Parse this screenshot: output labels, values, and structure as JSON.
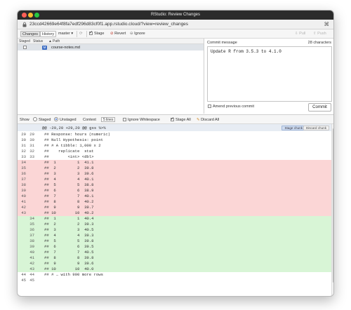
{
  "window": {
    "title": "RStudio: Review Changes"
  },
  "urlbar": {
    "url": "23ccd42669e64f8fa7edf296d83cf0f1.app.rstudio.cloud/?view=review_changes"
  },
  "toolbar": {
    "changes_label": "Changes",
    "history_label": "History",
    "branch_label": "master",
    "stage_label": "Stage",
    "revert_label": "Revert",
    "ignore_label": "Ignore",
    "pull_label": "Pull",
    "push_label": "Push"
  },
  "file_list": {
    "headers": {
      "staged": "Staged",
      "status": "Status",
      "path": "Path"
    },
    "files": [
      {
        "status": "M",
        "path": "course-notes.md",
        "staged": false
      }
    ]
  },
  "commit": {
    "label": "Commit message",
    "char_count": "28 characters",
    "message": "Update R from 3.5.3 to 4.1.0",
    "amend_label": "Amend previous commit",
    "commit_button": "Commit"
  },
  "diff_toolbar": {
    "show_label": "Show",
    "staged_label": "Staged",
    "unstaged_label": "Unstaged",
    "context_label": "Context",
    "context_value": "5 lines",
    "ignore_ws_label": "Ignore Whitespace",
    "stage_all_label": "Stage All",
    "discard_all_label": "Discard All",
    "show_selected": "Unstaged"
  },
  "diff": {
    "hunk_header": "@@ -29,20 +29,20 @@ gss %>%",
    "stage_chunk_label": "Stage chunk",
    "discard_chunk_label": "Discard chunk",
    "lines": [
      {
        "type": "context",
        "old": "29",
        "new": "29",
        "text": "## Response: hours (numeric)"
      },
      {
        "type": "context",
        "old": "30",
        "new": "30",
        "text": "## Null Hypothesis: point"
      },
      {
        "type": "context",
        "old": "31",
        "new": "31",
        "text": "## # A tibble: 1,000 x 2"
      },
      {
        "type": "context",
        "old": "32",
        "new": "32",
        "text": "##    replicate  stat"
      },
      {
        "type": "context",
        "old": "33",
        "new": "33",
        "text": "##        <int> <dbl>"
      },
      {
        "type": "del",
        "old": "34",
        "new": "",
        "text": "##  1         1  41.1"
      },
      {
        "type": "del",
        "old": "35",
        "new": "",
        "text": "##  2         2  39.8"
      },
      {
        "type": "del",
        "old": "36",
        "new": "",
        "text": "##  3         3  39.6"
      },
      {
        "type": "del",
        "old": "37",
        "new": "",
        "text": "##  4         4  40.1"
      },
      {
        "type": "del",
        "old": "38",
        "new": "",
        "text": "##  5         5  38.8"
      },
      {
        "type": "del",
        "old": "39",
        "new": "",
        "text": "##  6         6  38.9"
      },
      {
        "type": "del",
        "old": "40",
        "new": "",
        "text": "##  7         7  40.1"
      },
      {
        "type": "del",
        "old": "41",
        "new": "",
        "text": "##  8         8  40.2"
      },
      {
        "type": "del",
        "old": "42",
        "new": "",
        "text": "##  9         9  39.7"
      },
      {
        "type": "del",
        "old": "43",
        "new": "",
        "text": "## 10        10  40.2"
      },
      {
        "type": "add",
        "old": "",
        "new": "34",
        "text": "##  1         1  40.4"
      },
      {
        "type": "add",
        "old": "",
        "new": "35",
        "text": "##  2         2  39.3"
      },
      {
        "type": "add",
        "old": "",
        "new": "36",
        "text": "##  3         3  40.5"
      },
      {
        "type": "add",
        "old": "",
        "new": "37",
        "text": "##  4         4  39.3"
      },
      {
        "type": "add",
        "old": "",
        "new": "38",
        "text": "##  5         5  39.8"
      },
      {
        "type": "add",
        "old": "",
        "new": "39",
        "text": "##  6         6  39.5"
      },
      {
        "type": "add",
        "old": "",
        "new": "40",
        "text": "##  7         7  40.5"
      },
      {
        "type": "add",
        "old": "",
        "new": "41",
        "text": "##  8         8  39.8"
      },
      {
        "type": "add",
        "old": "",
        "new": "42",
        "text": "##  9         9  39.6"
      },
      {
        "type": "add",
        "old": "",
        "new": "43",
        "text": "## 10        10  40.0"
      },
      {
        "type": "context",
        "old": "44",
        "new": "44",
        "text": "## # … with 990 more rows"
      },
      {
        "type": "context",
        "old": "45",
        "new": "45",
        "text": ""
      }
    ]
  },
  "colors": {
    "del_bg": "#fbd6d6",
    "add_bg": "#d8f5d6",
    "accent": "#3a6fd6"
  }
}
